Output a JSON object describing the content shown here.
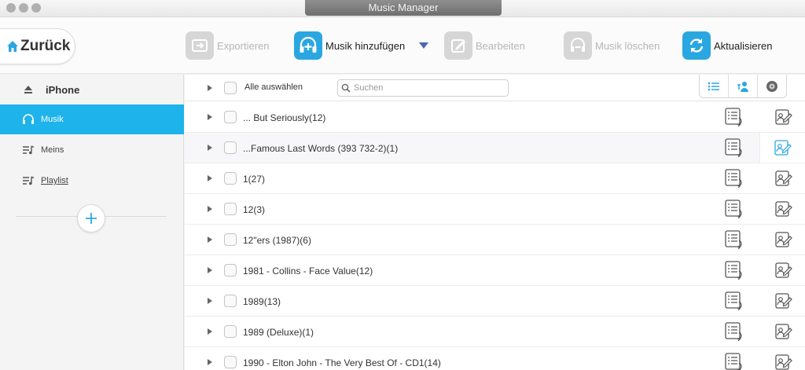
{
  "window": {
    "title": "Music Manager"
  },
  "toolbar": {
    "back_label": "Zurück",
    "export_label": "Exportieren",
    "add_music_label": "Musik hinzufügen",
    "edit_label": "Bearbeiten",
    "delete_label": "Musik löschen",
    "refresh_label": "Aktualisieren"
  },
  "sidebar": {
    "device": "iPhone",
    "items": [
      {
        "label": "Musik",
        "icon": "headphones-icon",
        "selected": true
      },
      {
        "label": "Meins",
        "icon": "playlist-icon",
        "selected": false
      },
      {
        "label": "Playlist",
        "icon": "playlist-icon",
        "selected": false
      }
    ]
  },
  "list": {
    "select_all_label": "Alle auswählen",
    "search_placeholder": "Suchen",
    "rows": [
      "... But Seriously(12)",
      "...Famous Last Words (393 732-2)(1)",
      "1(27)",
      "12(3)",
      "12\"ers (1987)(6)",
      "1981 - Collins - Face Value(12)",
      "1989(13)",
      "1989 (Deluxe)(1)",
      "1990 - Elton John - The Very Best Of - CD1(14)"
    ]
  },
  "colors": {
    "accent": "#1eb3ea",
    "toolbar_active": "#2aa7e0",
    "disabled": "#d6d6d6"
  }
}
